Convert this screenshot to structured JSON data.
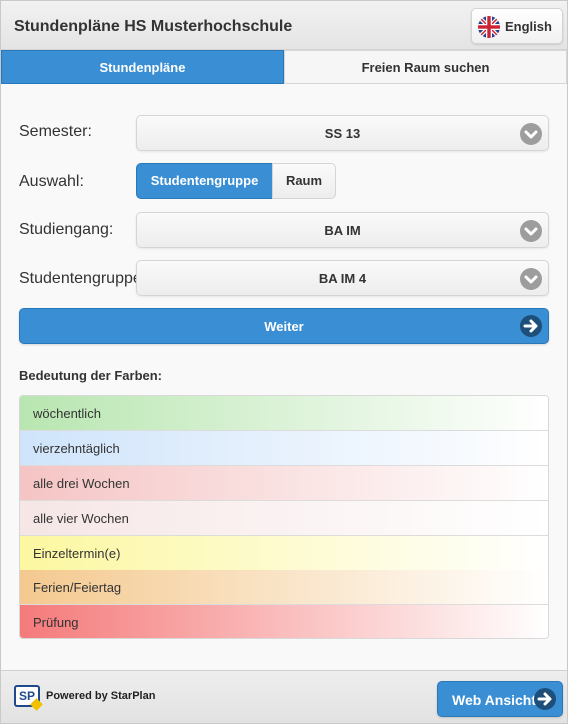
{
  "header": {
    "title": "Stundenpläne HS Musterhochschule",
    "language_label": "English"
  },
  "tabs": [
    {
      "label": "Stundenpläne",
      "active": true
    },
    {
      "label": "Freien Raum suchen",
      "active": false
    }
  ],
  "form": {
    "semester": {
      "label": "Semester:",
      "value": "SS 13"
    },
    "auswahl": {
      "label": "Auswahl:",
      "options": [
        "Studentengruppe",
        "Raum"
      ],
      "selected": "Studentengruppe"
    },
    "studiengang": {
      "label": "Studiengang:",
      "value": "BA IM"
    },
    "studentengruppe": {
      "label": "Studentengruppe",
      "value": "BA IM 4"
    },
    "weiter_label": "Weiter"
  },
  "legend": {
    "title": "Bedeutung der Farben:",
    "items": [
      {
        "label": "wöchentlich",
        "color": "#b8e6b0"
      },
      {
        "label": "vierzehntäglich",
        "color": "#cfe4fb"
      },
      {
        "label": "alle drei Wochen",
        "color": "#f5c4c4"
      },
      {
        "label": "alle vier Wochen",
        "color": "#f6e6e6"
      },
      {
        "label": "Einzeltermin(e)",
        "color": "#fcf7a0"
      },
      {
        "label": "Ferien/Feiertag",
        "color": "#f4c98f"
      },
      {
        "label": "Prüfung",
        "color": "#f57a7a"
      }
    ]
  },
  "footer": {
    "logo_text": "SP",
    "powered_by": "Powered by StarPlan",
    "web_button_label": "Web Ansicht"
  },
  "colors": {
    "accent": "#3a8ed3",
    "accent_dark": "#1d4f7a"
  }
}
